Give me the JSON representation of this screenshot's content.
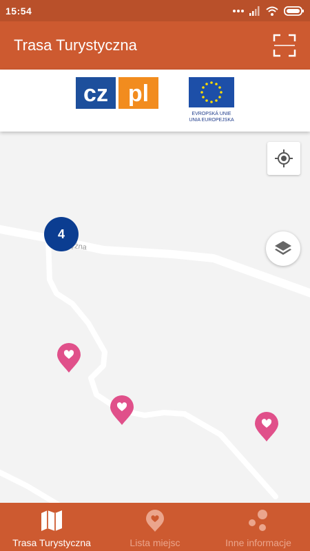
{
  "status_bar": {
    "time": "15:54"
  },
  "app_bar": {
    "title": "Trasa Turystyczna"
  },
  "logos": {
    "czpl": "cz pl",
    "eu_line1": "EVROPSKÁ UNIE",
    "eu_line2": "UNIA EUROPEJSKA"
  },
  "map": {
    "road_label": "ężna",
    "cluster_count": "4",
    "icons": {
      "locate": "my-location-icon",
      "layers": "layers-icon",
      "poi": "heart-pin-icon"
    }
  },
  "bottom_nav": {
    "items": [
      {
        "label": "Trasa Turystyczna",
        "icon": "map-icon",
        "active": true
      },
      {
        "label": "Lista miejsc",
        "icon": "heart-pin-icon",
        "active": false
      },
      {
        "label": "Inne informacje",
        "icon": "bubbles-icon",
        "active": false
      }
    ]
  },
  "colors": {
    "status_bar": "#b9502a",
    "primary": "#cd5a30",
    "cluster": "#0b3d91",
    "poi": "#e0508a",
    "map_bg": "#f3f3f3"
  }
}
